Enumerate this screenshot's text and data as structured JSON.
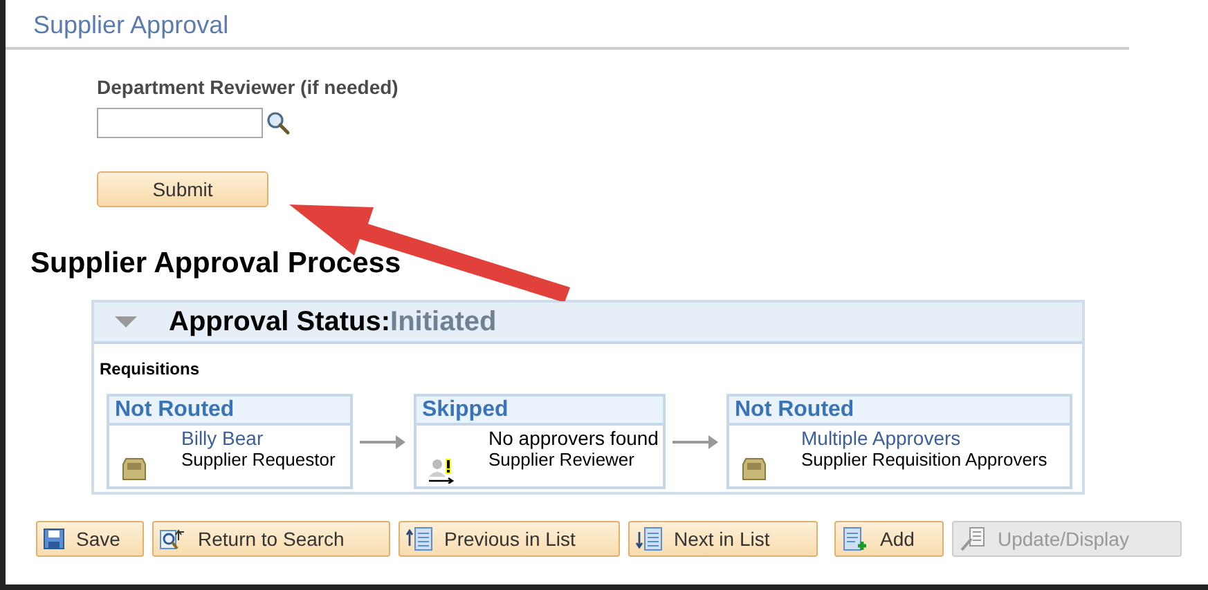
{
  "section_title": "Supplier Approval",
  "reviewer_field": {
    "label": "Department Reviewer (if needed)"
  },
  "submit_button": {
    "label": "Submit"
  },
  "process_heading": "Supplier Approval Process",
  "approval_panel": {
    "expanded": true,
    "status_label": "Approval Status:",
    "status_value": "Initiated",
    "group_label": "Requisitions",
    "steps": [
      {
        "status": "Not Routed",
        "kind": "pending",
        "name": "Billy Bear",
        "role": "Supplier Requestor"
      },
      {
        "status": "Skipped",
        "kind": "skipped",
        "name": "No approvers found",
        "role": "Supplier Reviewer"
      },
      {
        "status": "Not Routed",
        "kind": "pending",
        "name": "Multiple Approvers",
        "role": "Supplier Requisition Approvers"
      }
    ]
  },
  "toolbar": [
    {
      "label": "Save",
      "kind": "save",
      "disabled": false
    },
    {
      "label": "Return to Search",
      "kind": "return",
      "disabled": false
    },
    {
      "label": "Previous in List",
      "kind": "previous",
      "disabled": false
    },
    {
      "label": "Next in List",
      "kind": "next",
      "disabled": false
    },
    {
      "label": "Add",
      "kind": "add",
      "disabled": false
    },
    {
      "label": "Update/Display",
      "kind": "update",
      "disabled": true
    }
  ]
}
